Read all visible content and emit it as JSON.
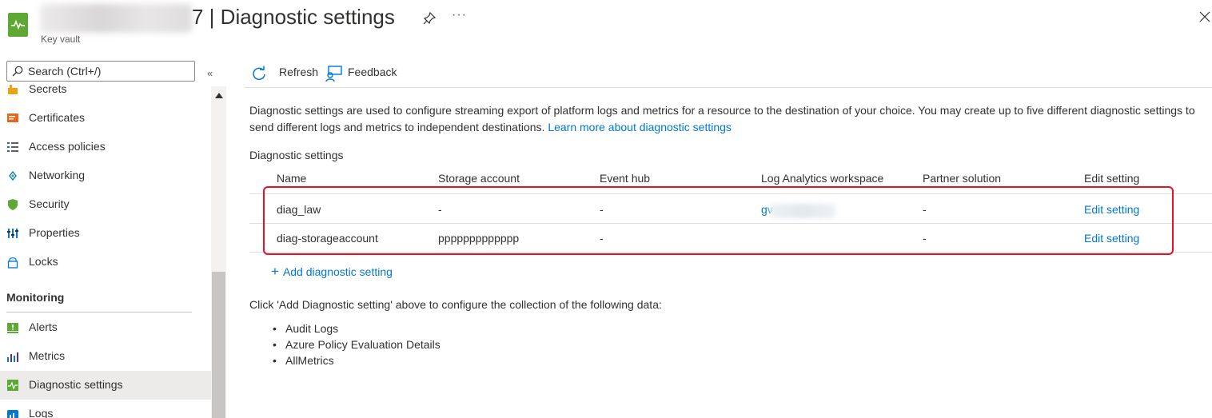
{
  "header": {
    "title": "7 | Diagnostic settings",
    "subtitle": "Key vault",
    "more_label": "···"
  },
  "sidebar": {
    "search_placeholder": "Search (Ctrl+/)",
    "collapse_label": "«",
    "items_top": [
      {
        "label": "Secrets",
        "icon": "key-icon"
      },
      {
        "label": "Certificates",
        "icon": "certificate-icon"
      },
      {
        "label": "Access policies",
        "icon": "access-policies-icon"
      },
      {
        "label": "Networking",
        "icon": "networking-icon"
      },
      {
        "label": "Security",
        "icon": "shield-icon"
      },
      {
        "label": "Properties",
        "icon": "properties-icon"
      },
      {
        "label": "Locks",
        "icon": "lock-icon"
      }
    ],
    "section_monitoring": "Monitoring",
    "items_monitoring": [
      {
        "label": "Alerts",
        "icon": "alert-icon"
      },
      {
        "label": "Metrics",
        "icon": "metrics-icon"
      },
      {
        "label": "Diagnostic settings",
        "icon": "diagnostic-icon",
        "active": true
      },
      {
        "label": "Logs",
        "icon": "logs-icon"
      }
    ]
  },
  "toolbar": {
    "refresh_label": "Refresh",
    "feedback_label": "Feedback"
  },
  "main": {
    "description": "Diagnostic settings are used to configure streaming export of platform logs and metrics for a resource to the destination of your choice. You may create up to five different diagnostic settings to send different logs and metrics to independent destinations.",
    "learn_more_link": "Learn more about diagnostic settings",
    "section_label": "Diagnostic settings",
    "table": {
      "columns": [
        "Name",
        "Storage account",
        "Event hub",
        "Log Analytics workspace",
        "Partner solution",
        "Edit setting"
      ],
      "rows": [
        {
          "name": "diag_law",
          "storage": "-",
          "event_hub": "-",
          "workspace": "gv",
          "partner": "-",
          "edit": "Edit setting"
        },
        {
          "name": "diag-storageaccount",
          "storage": "ppppppppppppp",
          "event_hub": "-",
          "workspace": "",
          "partner": "-",
          "edit": "Edit setting"
        }
      ]
    },
    "add_setting_label": "Add diagnostic setting",
    "add_setting_plus": "+",
    "collect_text": "Click 'Add Diagnostic setting' above to configure the collection of the following data:",
    "bullets": [
      "Audit Logs",
      "Azure Policy Evaluation Details",
      "AllMetrics"
    ]
  },
  "colors": {
    "accent": "#0078d4",
    "highlight": "#e81123",
    "resource_icon": "#5ea933"
  }
}
